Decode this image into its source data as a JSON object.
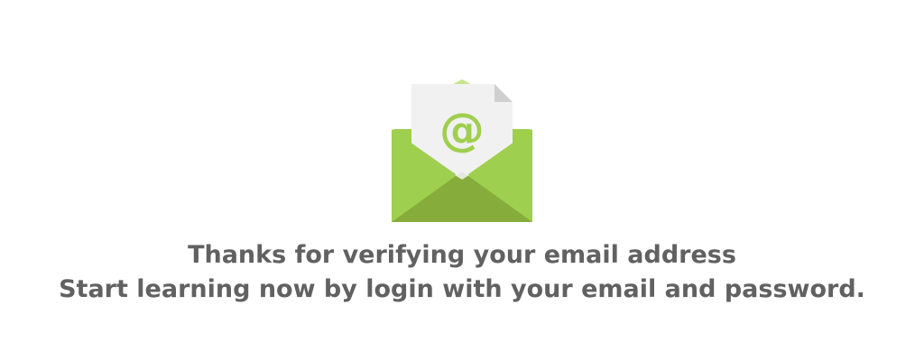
{
  "confirmation": {
    "icon": "email-envelope-icon",
    "letter_symbol": "@",
    "line1": "Thanks for verifying your email address",
    "line2": "Start learning now by login with your email and password.",
    "colors": {
      "envelope_green": "#9fcf4f",
      "envelope_dark": "#86ad3b",
      "envelope_light": "#c5e78a",
      "paper": "#f1f1f1",
      "paper_fold": "#cfcfcf",
      "at_symbol": "#9fcf4f",
      "text": "#616161"
    }
  }
}
